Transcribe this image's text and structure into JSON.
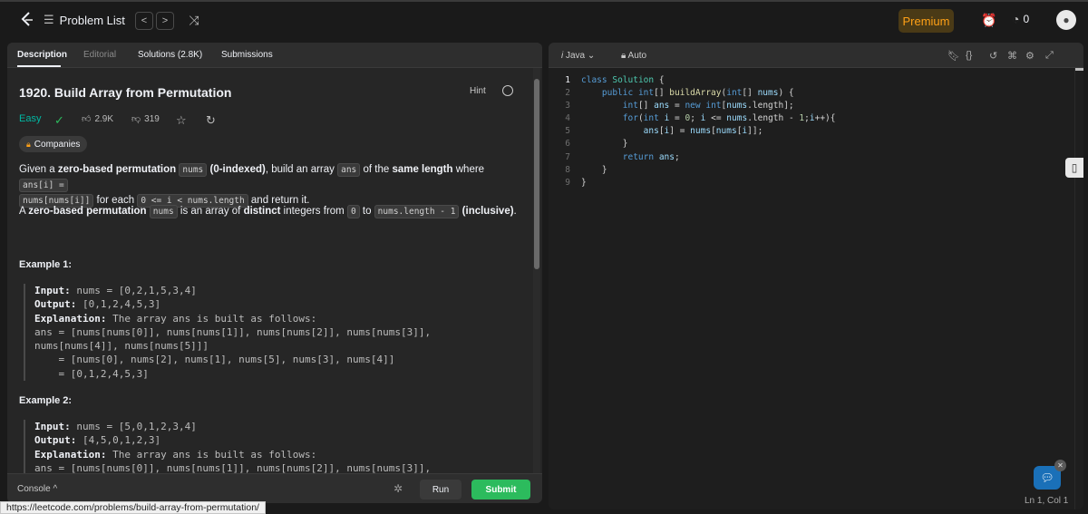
{
  "topbar": {
    "nav_label": "Problem List",
    "prev": "<",
    "next": ">",
    "premium": "Premium",
    "streak_count": "0"
  },
  "tabs": {
    "description": "Description",
    "editorial": "Editorial",
    "solutions": "Solutions (2.8K)",
    "submissions": "Submissions"
  },
  "problem": {
    "title": "1920. Build Array from Permutation",
    "hint": "Hint",
    "difficulty": "Easy",
    "likes": "2.9K",
    "dislikes": "319",
    "companies": "Companies"
  },
  "description": {
    "p1_a": "Given a ",
    "p1_b": "zero-based permutation",
    "p1_c": "nums",
    "p1_d": "(0-indexed)",
    "p1_e": ", build an array ",
    "p1_f": "ans",
    "p1_g": " of the ",
    "p1_h": "same length",
    "p1_i": " where ",
    "p1_j": "ans[i] =",
    "p1_k": "nums[nums[i]]",
    "p1_l": " for each ",
    "p1_m": "0 <= i < nums.length",
    "p1_n": " and return it.",
    "p2_a": "A ",
    "p2_b": "zero-based permutation",
    "p2_c": "nums",
    "p2_d": " is an array of ",
    "p2_e": "distinct",
    "p2_f": " integers from ",
    "p2_g": "0",
    "p2_h": " to ",
    "p2_i": "nums.length - 1",
    "p2_j": " (inclusive)",
    "p2_k": "."
  },
  "examples": [
    {
      "title": "Example 1:",
      "input_label": "Input:",
      "input": " nums = [0,2,1,5,3,4]",
      "output_label": "Output:",
      "output": " [0,1,2,4,5,3]",
      "expl_label": "Explanation:",
      "expl": " The array ans is built as follows:",
      "lines": [
        "ans = [nums[nums[0]], nums[nums[1]], nums[nums[2]], nums[nums[3]],",
        "nums[nums[4]], nums[nums[5]]]",
        "    = [nums[0], nums[2], nums[1], nums[5], nums[3], nums[4]]",
        "    = [0,1,2,4,5,3]"
      ]
    },
    {
      "title": "Example 2:",
      "input_label": "Input:",
      "input": " nums = [5,0,1,2,3,4]",
      "output_label": "Output:",
      "output": " [4,5,0,1,2,3]",
      "expl_label": "Explanation:",
      "expl": " The array ans is built as follows:",
      "lines": [
        "ans = [nums[nums[0]], nums[nums[1]], nums[nums[2]], nums[nums[3]],"
      ]
    }
  ],
  "console": {
    "label": "Console",
    "run": "Run",
    "submit": "Submit"
  },
  "status_url": "https://leetcode.com/problems/build-array-from-permutation/",
  "editor": {
    "language": "Java",
    "mode": "Auto",
    "cursor": "Ln 1, Col 1",
    "line_numbers": [
      "1",
      "2",
      "3",
      "4",
      "5",
      "6",
      "7",
      "8",
      "9"
    ]
  },
  "colors": {
    "accent_premium": "#ffa116",
    "easy": "#00b8a3",
    "submit": "#2cbb5d"
  }
}
